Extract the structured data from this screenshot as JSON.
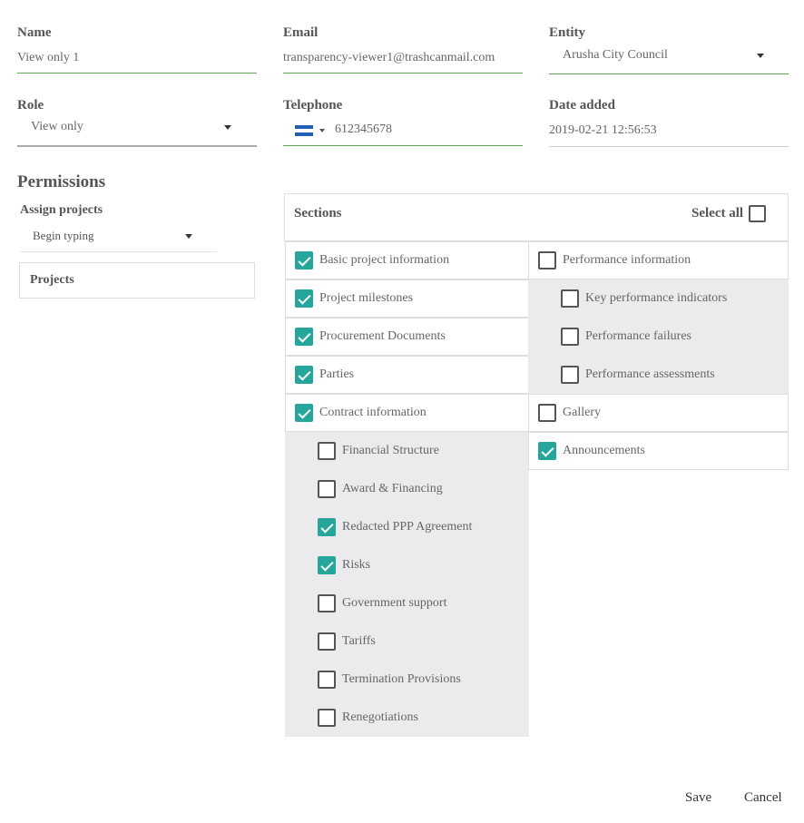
{
  "form": {
    "name": {
      "label": "Name",
      "value": "View only 1"
    },
    "email": {
      "label": "Email",
      "value": "transparency-viewer1@trashcanmail.com"
    },
    "entity": {
      "label": "Entity",
      "value": "Arusha City Council"
    },
    "role": {
      "label": "Role",
      "value": "View only"
    },
    "telephone": {
      "label": "Telephone",
      "value": "612345678",
      "flag": "nicaragua-flag-icon"
    },
    "date_added": {
      "label": "Date added",
      "value": "2019-02-21 12:56:53"
    }
  },
  "permissions": {
    "title": "Permissions",
    "assign_projects": {
      "label": "Assign projects",
      "placeholder": "Begin typing"
    },
    "projects_header": "Projects"
  },
  "sections": {
    "header": "Sections",
    "select_all_label": "Select all",
    "left": [
      {
        "label": "Basic project information",
        "checked": true,
        "sub": false
      },
      {
        "label": "Project milestones",
        "checked": true,
        "sub": false
      },
      {
        "label": "Procurement Documents",
        "checked": true,
        "sub": false
      },
      {
        "label": "Parties",
        "checked": true,
        "sub": false
      },
      {
        "label": "Contract information",
        "checked": true,
        "sub": false
      },
      {
        "label": "Financial Structure",
        "checked": false,
        "sub": true
      },
      {
        "label": "Award & Financing",
        "checked": false,
        "sub": true
      },
      {
        "label": "Redacted PPP Agreement",
        "checked": true,
        "sub": true
      },
      {
        "label": "Risks",
        "checked": true,
        "sub": true
      },
      {
        "label": "Government support",
        "checked": false,
        "sub": true
      },
      {
        "label": "Tariffs",
        "checked": false,
        "sub": true
      },
      {
        "label": "Termination Provisions",
        "checked": false,
        "sub": true
      },
      {
        "label": "Renegotiations",
        "checked": false,
        "sub": true
      }
    ],
    "right": [
      {
        "label": "Performance information",
        "checked": false,
        "sub": false
      },
      {
        "label": "Key performance indicators",
        "checked": false,
        "sub": true
      },
      {
        "label": "Performance failures",
        "checked": false,
        "sub": true
      },
      {
        "label": "Performance assessments",
        "checked": false,
        "sub": true
      },
      {
        "label": "Gallery",
        "checked": false,
        "sub": false
      },
      {
        "label": "Announcements",
        "checked": true,
        "sub": false
      }
    ]
  },
  "actions": {
    "save_label": "Save",
    "cancel_label": "Cancel"
  },
  "colors": {
    "accent": "#26a69a",
    "active_underline": "#63a35a"
  }
}
